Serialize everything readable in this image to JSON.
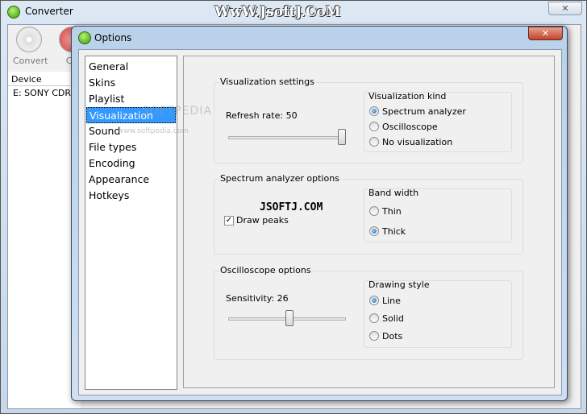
{
  "main_window": {
    "title": "Converter",
    "watermark": "WwW.JsoftJ.CoM",
    "close_icon": "close-icon",
    "toolbar": [
      {
        "label": "Convert",
        "icon": "disc-icon"
      },
      {
        "label": "Ca",
        "icon": "cancel-icon"
      }
    ],
    "device_header": "Device",
    "devices": [
      "E: SONY CDRW"
    ]
  },
  "dialog": {
    "title": "Options",
    "close_icon": "close-icon",
    "nav": [
      {
        "label": "General"
      },
      {
        "label": "Skins"
      },
      {
        "label": "Playlist"
      },
      {
        "label": "Visualization",
        "selected": true
      },
      {
        "label": "Sound"
      },
      {
        "label": "File types"
      },
      {
        "label": "Encoding"
      },
      {
        "label": "Appearance"
      },
      {
        "label": "Hotkeys"
      }
    ],
    "nav_watermark": "SOFTPEDIA",
    "nav_watermark_sub": "www.softpedia.com",
    "vis": {
      "title": "Visualization settings",
      "refresh_label": "Refresh rate: 50",
      "refresh_value": 50,
      "kind_title": "Visualization kind",
      "kinds": [
        "Spectrum analyzer",
        "Oscilloscope",
        "No visualization"
      ],
      "kind_selected": "Spectrum analyzer"
    },
    "spectrum": {
      "title": "Spectrum analyzer options",
      "watermark": "JSOFTJ.COM",
      "draw_peaks_label": "Draw peaks",
      "draw_peaks": true,
      "band_title": "Band width",
      "bands": [
        "Thin",
        "Thick"
      ],
      "band_selected": "Thick"
    },
    "osc": {
      "title": "Oscilloscope options",
      "sensitivity_label": "Sensitivity: 26",
      "sensitivity_value": 26,
      "style_title": "Drawing style",
      "styles": [
        "Line",
        "Solid",
        "Dots"
      ],
      "style_selected": "Line"
    }
  }
}
